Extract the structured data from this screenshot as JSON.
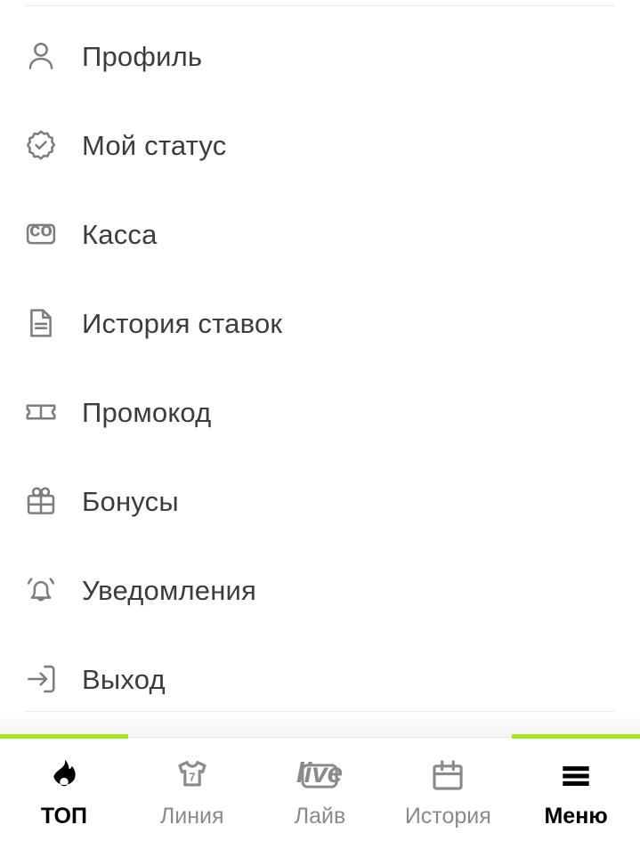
{
  "theme": {
    "accent_green": "#a5e81b",
    "icon_gray": "#7d7d7d",
    "label_dark": "#3c3c3c",
    "nav_inactive": "#8a8a8a",
    "nav_active": "#000000",
    "background": "#ffffff"
  },
  "menu": {
    "items": [
      {
        "label": "Профиль",
        "icon": "person-icon"
      },
      {
        "label": "Мой статус",
        "icon": "verified-badge-icon"
      },
      {
        "label": "Касса",
        "icon": "wallet-icon"
      },
      {
        "label": "История ставок",
        "icon": "document-icon"
      },
      {
        "label": "Промокод",
        "icon": "ticket-icon"
      },
      {
        "label": "Бонусы",
        "icon": "gift-icon"
      },
      {
        "label": "Уведомления",
        "icon": "bell-icon"
      },
      {
        "label": "Выход",
        "icon": "logout-icon"
      }
    ]
  },
  "bottom_nav": {
    "items": [
      {
        "label": "ТОП",
        "icon": "flame-icon",
        "active": true
      },
      {
        "label": "Линия",
        "icon": "jersey-icon",
        "active": false,
        "badge_number": "7"
      },
      {
        "label": "Лайв",
        "icon": "live-icon",
        "active": false,
        "badge_text": "live"
      },
      {
        "label": "История",
        "icon": "calendar-icon",
        "active": false
      },
      {
        "label": "Меню",
        "icon": "hamburger-icon",
        "active": true
      }
    ]
  }
}
